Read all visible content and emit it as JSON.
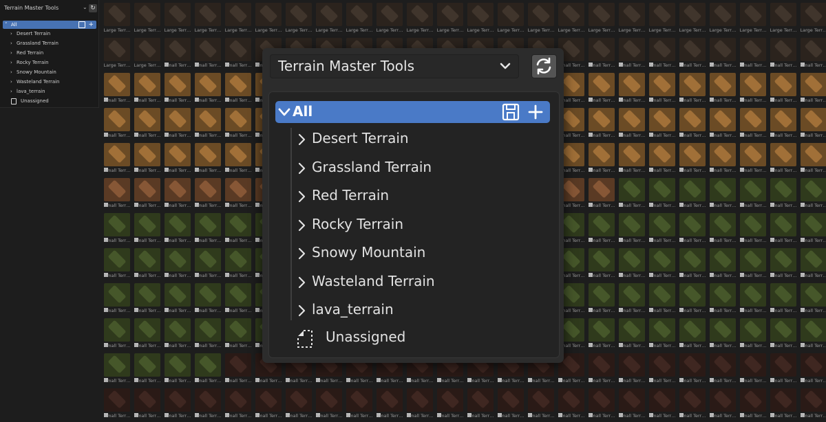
{
  "sidebar": {
    "title": "Terrain Master Tools",
    "all_label": "All",
    "items": [
      "Desert Terrain",
      "Grassland Terrain",
      "Red Terrain",
      "Rocky Terrain",
      "Snowy Mountain",
      "Wasteland Terrain",
      "lava_terrain"
    ],
    "unassigned_label": "Unassigned"
  },
  "grid": {
    "caption_large": "Large Terr…",
    "caption_small": "Small Terr…"
  },
  "panel": {
    "library_select": "Terrain Master Tools",
    "all_label": "All",
    "categories": [
      "Desert Terrain",
      "Grassland Terrain",
      "Red Terrain",
      "Rocky Terrain",
      "Snowy Mountain",
      "Wasteland Terrain",
      "lava_terrain"
    ],
    "unassigned_label": "Unassigned"
  },
  "colors": {
    "selected_row": "#4a7ac7",
    "panel_bg": "#2c2c2c",
    "app_bg": "#1d1d1d"
  },
  "icons": {
    "dropdown": "chevron-down-icon",
    "refresh": "refresh-icon",
    "save": "save-icon",
    "add": "plus-icon",
    "expand": "chevron-right-icon",
    "unassigned": "unassigned-doc-icon"
  }
}
